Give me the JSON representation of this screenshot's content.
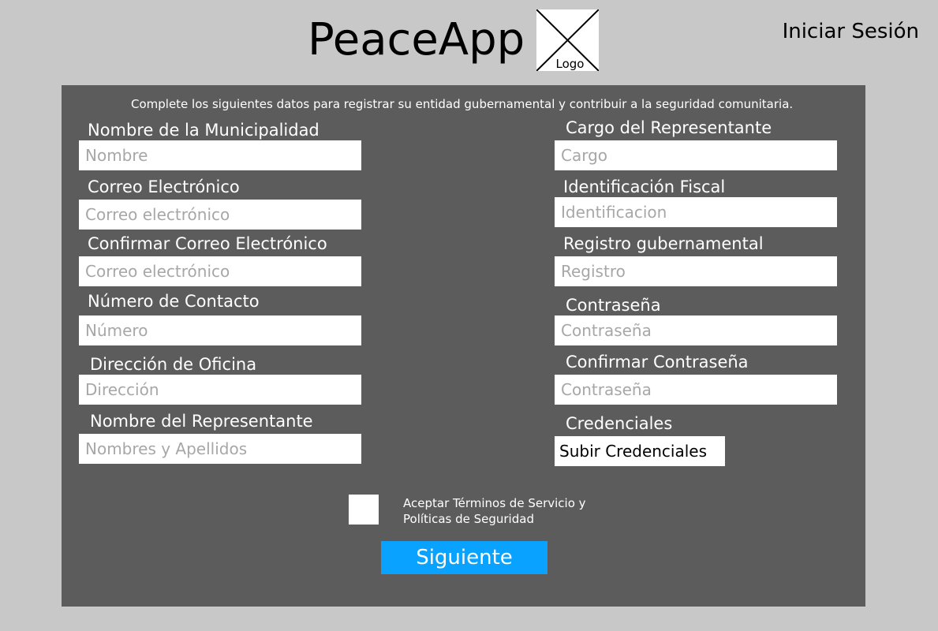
{
  "header": {
    "app_name": "PeaceApp",
    "logo_label": "Logo",
    "login_label": "Iniciar Sesión"
  },
  "form": {
    "intro": "Complete los siguientes datos para registrar su entidad gubernamental y contribuir a la seguridad comunitaria.",
    "left_fields": [
      {
        "label": "Nombre de la Municipalidad",
        "placeholder": "Nombre",
        "value": ""
      },
      {
        "label": "Correo Electrónico",
        "placeholder": "Correo electrónico",
        "value": ""
      },
      {
        "label": "Confirmar Correo Electrónico",
        "placeholder": "Correo electrónico",
        "value": ""
      },
      {
        "label": "Número de Contacto",
        "placeholder": "Número",
        "value": ""
      },
      {
        "label": "Dirección de Oficina",
        "placeholder": "Dirección",
        "value": ""
      },
      {
        "label": "Nombre del Representante",
        "placeholder": "Nombres y Apellidos",
        "value": ""
      }
    ],
    "right_fields": [
      {
        "label": "Cargo del Representante",
        "placeholder": "Cargo",
        "value": ""
      },
      {
        "label": "Identificación Fiscal",
        "placeholder": "Identificacion",
        "value": ""
      },
      {
        "label": "Registro gubernamental",
        "placeholder": "Registro",
        "value": ""
      },
      {
        "label": "Contraseña",
        "placeholder": "Contraseña",
        "value": ""
      },
      {
        "label": "Confirmar Contraseña",
        "placeholder": "Contraseña",
        "value": ""
      }
    ],
    "credentials": {
      "label": "Credenciales",
      "button_label": "Subir Credenciales"
    },
    "terms": {
      "checked": false,
      "text": "Aceptar Términos de Servicio y Políticas de Seguridad"
    },
    "next_button_label": "Siguiente"
  },
  "colors": {
    "page_background": "#c8c8c8",
    "panel_background": "#5c5c5c",
    "accent": "#0aa2ff",
    "placeholder": "#a7a7a7"
  }
}
